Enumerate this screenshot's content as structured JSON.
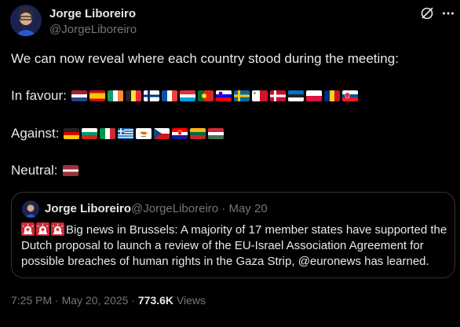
{
  "tweet": {
    "author_name": "Jorge Liboreiro",
    "author_handle": "@JorgeLiboreiro",
    "intro": "We can now reveal where each country stood during the meeting:",
    "favour_label": "In favour:",
    "against_label": "Against:",
    "neutral_label": "Neutral:",
    "favour_flags": [
      "netherlands-flag",
      "spain-flag",
      "ireland-flag",
      "belgium-flag",
      "finland-flag",
      "france-flag",
      "luxembourg-flag",
      "portugal-flag",
      "slovenia-flag",
      "sweden-flag",
      "malta-flag",
      "denmark-flag",
      "estonia-flag",
      "poland-flag",
      "romania-flag",
      "slovakia-flag"
    ],
    "against_flags": [
      "germany-flag",
      "bulgaria-flag",
      "italy-flag",
      "greece-flag",
      "cyprus-flag",
      "czechia-flag",
      "croatia-flag",
      "lithuania-flag",
      "hungary-flag"
    ],
    "neutral_flags": [
      "latvia-flag"
    ]
  },
  "quote": {
    "author_name": "Jorge Liboreiro",
    "author_handle": "@JorgeLiboreiro",
    "separator": "·",
    "date": "May 20",
    "siren_icons": [
      "siren-icon",
      "siren-icon",
      "siren-icon"
    ],
    "body": "Big news in Brussels: A majority of 17 member states have supported the Dutch proposal to launch a review of the EU-Israel Association Agreement for possible breaches of human rights in the Gaza Strip, @euronews has learned."
  },
  "meta": {
    "time": "7:25 PM",
    "separator": "·",
    "date": "May 20, 2025",
    "views_count": "773.6K",
    "views_label": "Views"
  },
  "colors": {
    "background": "#000000",
    "text": "#e7e9ea",
    "muted": "#71767b",
    "border": "#2f3336"
  }
}
